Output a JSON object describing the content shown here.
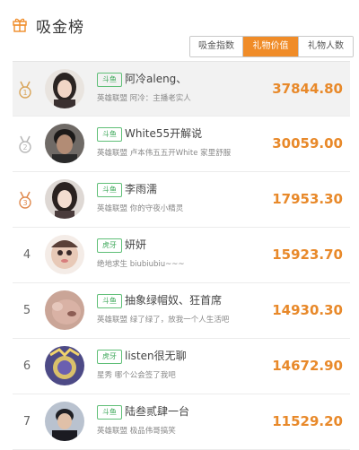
{
  "header": {
    "title": "吸金榜"
  },
  "tabs": [
    {
      "label": "吸金指数",
      "active": false
    },
    {
      "label": "礼物价值",
      "active": true
    },
    {
      "label": "礼物人数",
      "active": false
    }
  ],
  "colors": {
    "accent": "#f08c28",
    "value": "#e8892a",
    "tag_border": "#5fbf77"
  },
  "rows": [
    {
      "rank": "1",
      "tag": "斗鱼",
      "name": "阿冷aleng、",
      "desc": "英雄联盟 阿冷：主播老实人",
      "value": "37844.80",
      "medal": "gold"
    },
    {
      "rank": "2",
      "tag": "斗鱼",
      "name": "White55开解说",
      "desc": "英雄联盟 卢本伟五五开White 家里舒服",
      "value": "30059.00",
      "medal": "silver"
    },
    {
      "rank": "3",
      "tag": "斗鱼",
      "name": "李雨濡",
      "desc": "英雄联盟 你的守夜小精灵",
      "value": "17953.30",
      "medal": "bronze"
    },
    {
      "rank": "4",
      "tag": "虎牙",
      "name": "妍妍",
      "desc": "绝地求生 biubiubiu~~~",
      "value": "15923.70"
    },
    {
      "rank": "5",
      "tag": "斗鱼",
      "name": "抽象绿帽奴、狂首席",
      "desc": "英雄联盟 绿了绿了，放我一个人生活吧",
      "value": "14930.30"
    },
    {
      "rank": "6",
      "tag": "虎牙",
      "name": "listen很无聊",
      "desc": "星秀 哪个公会签了我吧",
      "value": "14672.90"
    },
    {
      "rank": "7",
      "tag": "斗鱼",
      "name": "陆叁贰肆一台",
      "desc": "英雄联盟 极品伟哥搞笑",
      "value": "11529.20"
    }
  ]
}
